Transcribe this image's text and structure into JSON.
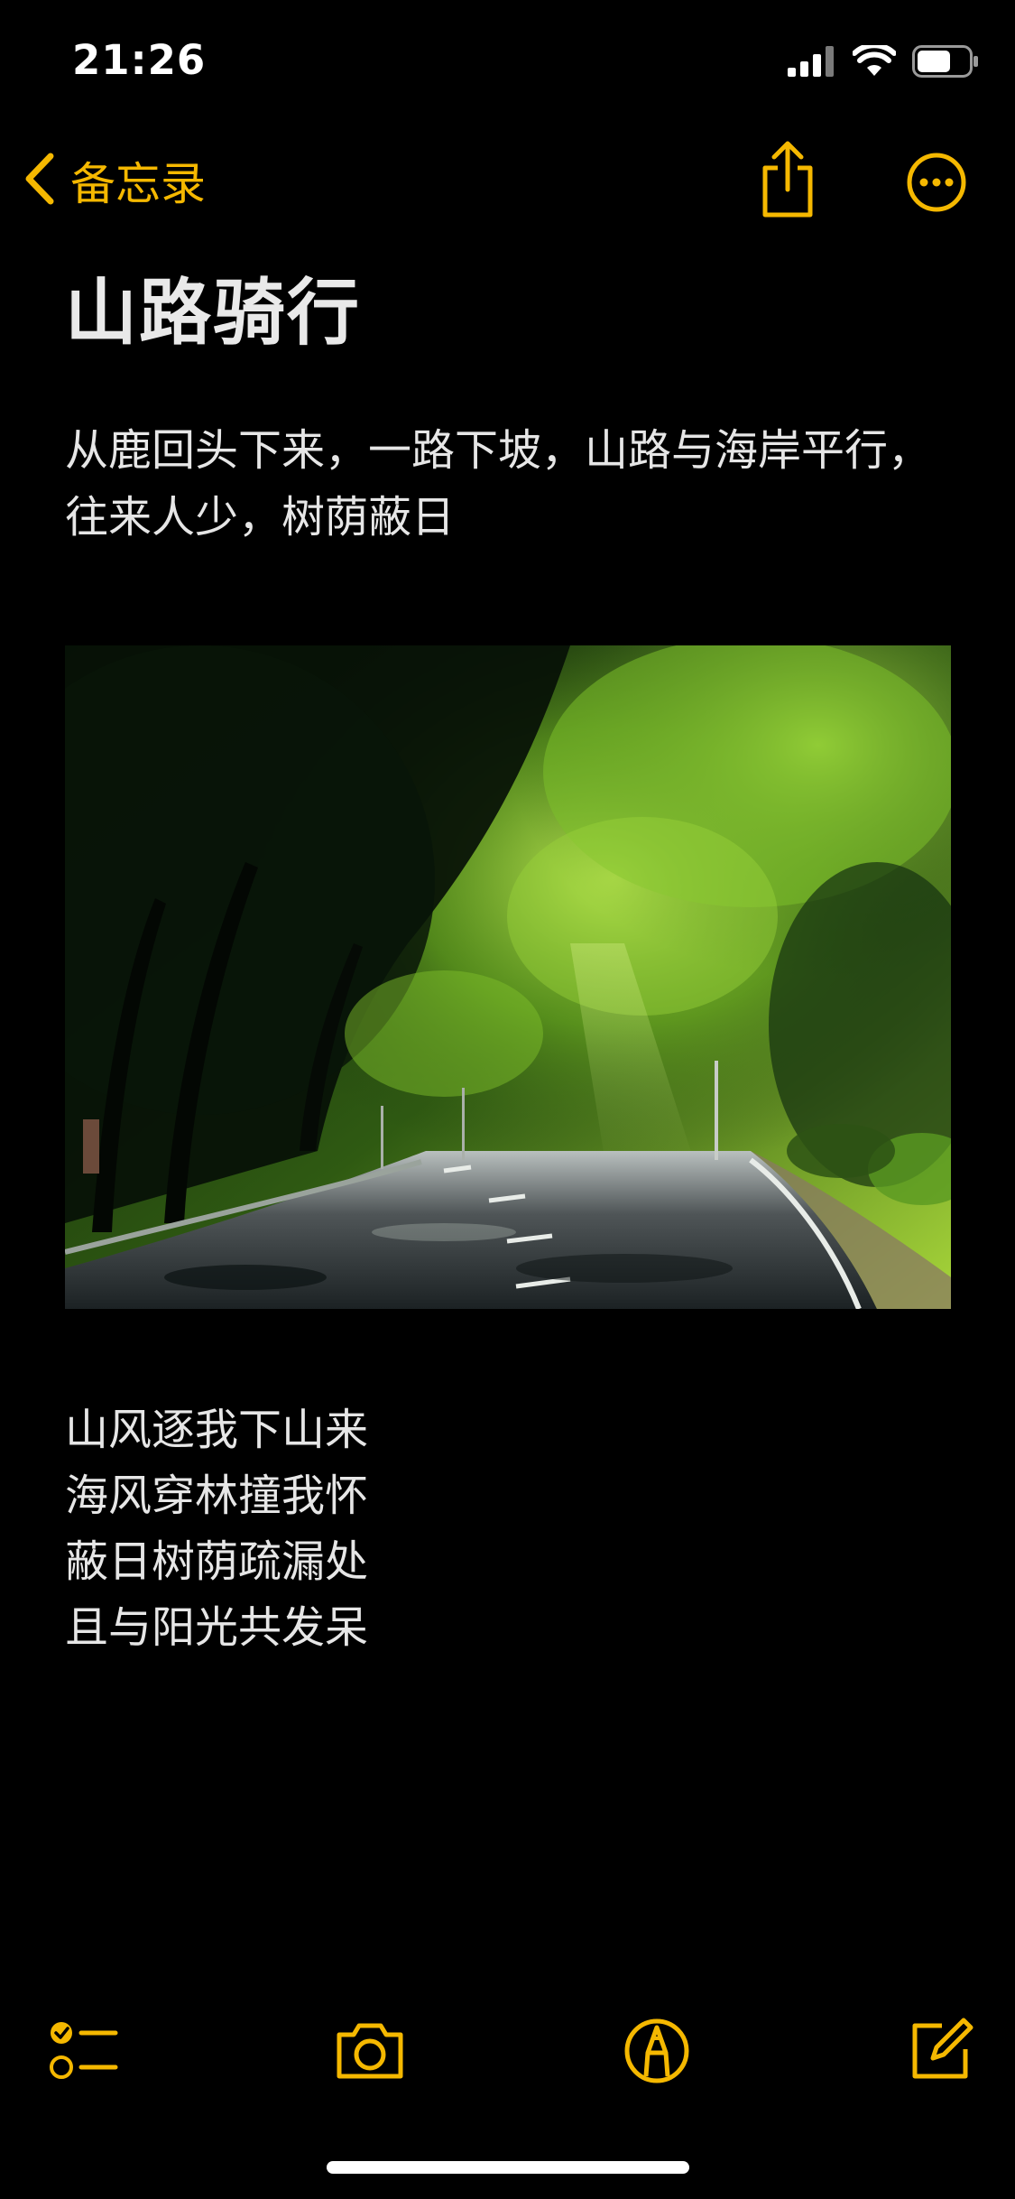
{
  "status_bar": {
    "time": "21:26",
    "icons": [
      "cellular-signal-icon",
      "wifi-icon",
      "battery-icon"
    ]
  },
  "nav": {
    "back_label": "备忘录",
    "actions": [
      "share-icon",
      "more-icon"
    ]
  },
  "note": {
    "title": "山路骑行",
    "paragraph": "从鹿回头下来，一路下坡，山路与海岸平行，往来人少，树荫蔽日",
    "photo": "tree-shaded-road",
    "poem": [
      "山风逐我下山来",
      "海风穿林撞我怀",
      "蔽日树荫疏漏处",
      "且与阳光共发呆"
    ]
  },
  "toolbar": {
    "items": [
      "checklist-icon",
      "camera-icon",
      "markup-icon",
      "compose-icon"
    ]
  },
  "colors": {
    "background": "#000000",
    "accent": "#f5b800",
    "title": "#e9e9e9",
    "body_text": "#e6e6e6"
  }
}
